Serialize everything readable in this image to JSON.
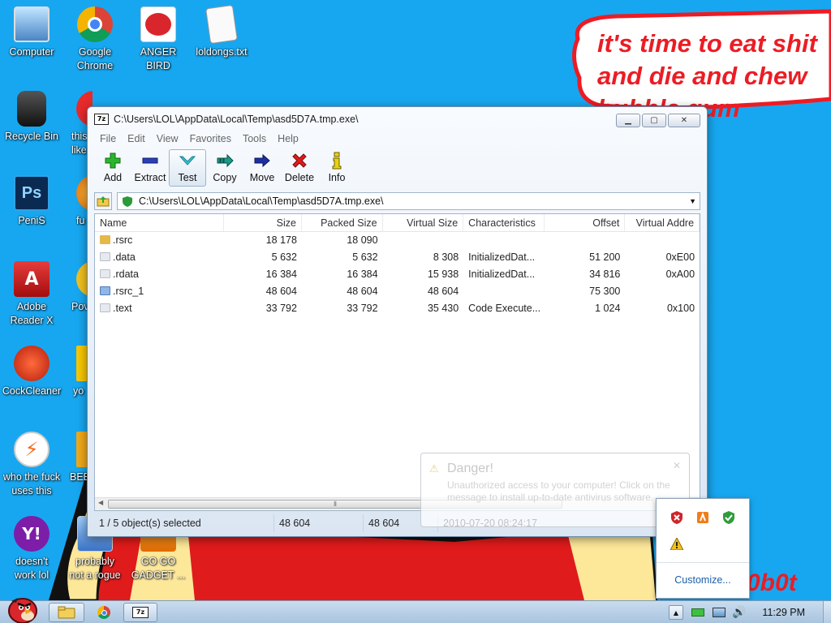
{
  "desktop": {
    "meme_text": "it's time to eat shit\nand die and chew\nbubble gum",
    "corner_text": "0b0t",
    "icons": [
      {
        "label": "Computer"
      },
      {
        "label": "Google\nChrome"
      },
      {
        "label": "ANGER\nBIRD"
      },
      {
        "label": "loldongs.txt"
      },
      {
        "label": "Recycle Bin"
      },
      {
        "label": "this\nlike"
      },
      {
        "label": "PeniS"
      },
      {
        "label": "fu"
      },
      {
        "label": "Adobe\nReader X"
      },
      {
        "label": "Pov"
      },
      {
        "label": "CockCleaner"
      },
      {
        "label": "yo"
      },
      {
        "label": "who the fuck\nuses this"
      },
      {
        "label": "BEE"
      },
      {
        "label": "doesn't\nwork lol"
      },
      {
        "label": "probably\nnot a rogue"
      },
      {
        "label": "GO GO\nGADGET ..."
      }
    ]
  },
  "window": {
    "title": "C:\\Users\\LOL\\AppData\\Local\\Temp\\asd5D7A.tmp.exe\\",
    "app_icon": "7z",
    "menu": [
      "File",
      "Edit",
      "View",
      "Favorites",
      "Tools",
      "Help"
    ],
    "toolbar": [
      {
        "label": "Add",
        "icon": "plus-icon"
      },
      {
        "label": "Extract",
        "icon": "minus-icon"
      },
      {
        "label": "Test",
        "icon": "checkmark-icon"
      },
      {
        "label": "Copy",
        "icon": "copy-arrow-icon"
      },
      {
        "label": "Move",
        "icon": "move-arrow-icon"
      },
      {
        "label": "Delete",
        "icon": "delete-x-icon"
      },
      {
        "label": "Info",
        "icon": "info-icon"
      }
    ],
    "address": "C:\\Users\\LOL\\AppData\\Local\\Temp\\asd5D7A.tmp.exe\\",
    "columns": [
      "Name",
      "Size",
      "Packed Size",
      "Virtual Size",
      "Characteristics",
      "Offset",
      "Virtual Addre"
    ],
    "rows": [
      {
        "name": ".rsrc",
        "size": "18 178",
        "packed": "18 090",
        "virtual": "",
        "chars": "",
        "offset": "",
        "vaddr": ""
      },
      {
        "name": ".data",
        "size": "5 632",
        "packed": "5 632",
        "virtual": "8 308",
        "chars": "InitializedDat...",
        "offset": "51 200",
        "vaddr": "0xE00"
      },
      {
        "name": ".rdata",
        "size": "16 384",
        "packed": "16 384",
        "virtual": "15 938",
        "chars": "InitializedDat...",
        "offset": "34 816",
        "vaddr": "0xA00"
      },
      {
        "name": ".rsrc_1",
        "size": "48 604",
        "packed": "48 604",
        "virtual": "48 604",
        "chars": "",
        "offset": "75 300",
        "vaddr": ""
      },
      {
        "name": ".text",
        "size": "33 792",
        "packed": "33 792",
        "virtual": "35 430",
        "chars": "Code Execute...",
        "offset": "1 024",
        "vaddr": "0x100"
      }
    ],
    "status": {
      "selected": "1 / 5 object(s) selected",
      "size": "48 604",
      "packed": "48 604",
      "date": "2010-07-20 08:24:17"
    }
  },
  "balloon": {
    "title": "Danger!",
    "message": "Unauthorized access to your computer! Click on the message to install up-to-date antivirus software."
  },
  "tray_flyout": {
    "customize": "Customize..."
  },
  "taskbar": {
    "clock": "11:29 PM"
  },
  "colors": {
    "desktop": "#17a7f0",
    "meme_red": "#ec1c24",
    "link_blue": "#1d5fa8"
  }
}
